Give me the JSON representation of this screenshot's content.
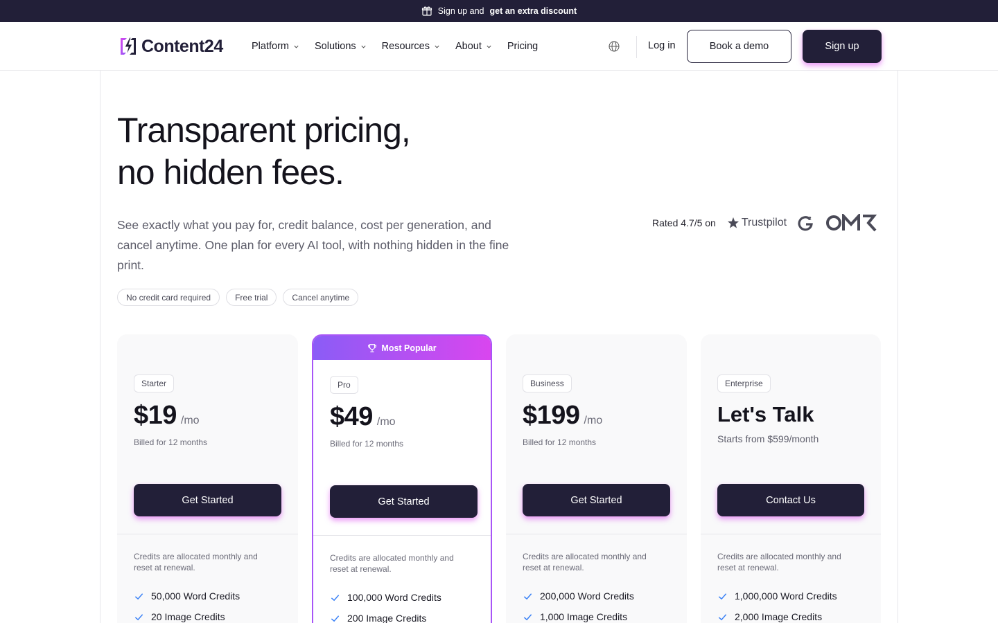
{
  "announcement": {
    "prefix": "Sign up and",
    "bold": "get an extra discount"
  },
  "nav": {
    "logo": "Content24",
    "items": [
      {
        "label": "Platform",
        "dropdown": true
      },
      {
        "label": "Solutions",
        "dropdown": true
      },
      {
        "label": "Resources",
        "dropdown": true
      },
      {
        "label": "About",
        "dropdown": true
      },
      {
        "label": "Pricing",
        "dropdown": false
      }
    ],
    "login": "Log in",
    "demo": "Book a demo",
    "signup": "Sign up"
  },
  "hero": {
    "title_line1": "Transparent pricing,",
    "title_line2": "no hidden fees.",
    "subtitle": "See exactly what you pay for, credit balance, cost per generation, and cancel anytime. One plan for every AI tool, with nothing hidden in the fine print.",
    "chips": [
      "No credit card required",
      "Free trial",
      "Cancel anytime"
    ],
    "rating": "Rated 4.7/5 on",
    "rating_sites": [
      "Trustpilot",
      "G2",
      "OMR"
    ]
  },
  "colors": {
    "dark": "#221f38",
    "accent_start": "#8b5cf6",
    "accent_end": "#d946ef",
    "check": "#3b82f6"
  },
  "plans": [
    {
      "tier": "Starter",
      "price": "$19",
      "unit": "/mo",
      "billed": "Billed for 12 months",
      "cta": "Get Started",
      "alloc": "Credits are allocated monthly and reset at renewal.",
      "features": [
        "50,000 Word Credits",
        "20 Image Credits"
      ]
    },
    {
      "tier": "Pro",
      "badge": "Most Popular",
      "price": "$49",
      "unit": "/mo",
      "billed": "Billed for 12 months",
      "cta": "Get Started",
      "alloc": "Credits are allocated monthly and reset at renewal.",
      "features": [
        "100,000 Word Credits",
        "200 Image Credits"
      ]
    },
    {
      "tier": "Business",
      "price": "$199",
      "unit": "/mo",
      "billed": "Billed for 12 months",
      "cta": "Get Started",
      "alloc": "Credits are allocated monthly and reset at renewal.",
      "features": [
        "200,000 Word Credits",
        "1,000 Image Credits"
      ]
    },
    {
      "tier": "Enterprise",
      "price": "Let's Talk",
      "starts": "Starts from $599/month",
      "cta": "Contact Us",
      "alloc": "Credits are allocated monthly and reset at renewal.",
      "features": [
        "1,000,000 Word Credits",
        "2,000 Image Credits"
      ]
    }
  ]
}
